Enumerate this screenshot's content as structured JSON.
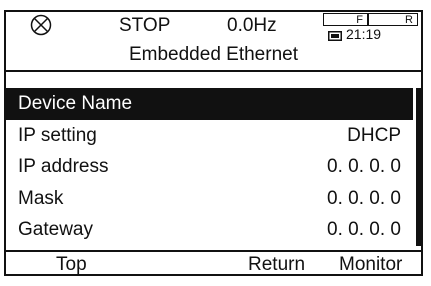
{
  "status": {
    "icon": "stop-circle-x-icon",
    "state": "STOP",
    "frequency": "0.0Hz",
    "indicator_f": "F",
    "indicator_r": "R",
    "battery_icon": "battery-icon",
    "time": "21:19"
  },
  "header": {
    "title": "Embedded Ethernet"
  },
  "menu": {
    "items": [
      {
        "label": "Device Name",
        "value": ""
      },
      {
        "label": "IP setting",
        "value": "DHCP"
      },
      {
        "label": "IP address",
        "value": "0. 0. 0. 0"
      },
      {
        "label": "Mask",
        "value": "0. 0. 0. 0"
      },
      {
        "label": "Gateway",
        "value": "0. 0. 0. 0"
      }
    ],
    "selected_index": 0
  },
  "function_keys": {
    "left": "Top",
    "middle": "Return",
    "right": "Monitor"
  },
  "colors": {
    "foreground": "#111111",
    "background": "#ffffff"
  }
}
